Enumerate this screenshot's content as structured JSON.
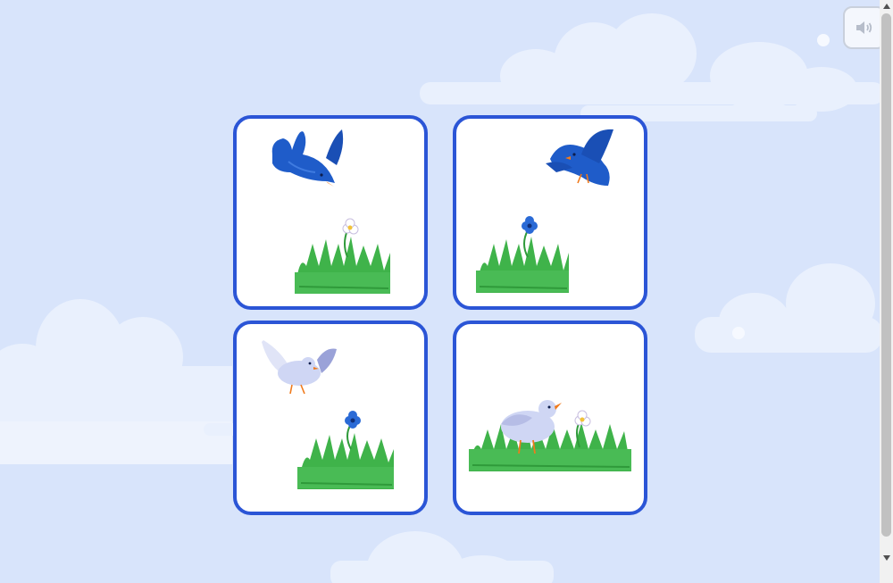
{
  "sound_button": {
    "icon": "speaker-icon",
    "state": "disabled"
  },
  "colors": {
    "sky": "#d8e4fb",
    "cloud": "#eef3fd",
    "card_border": "#2b55d6",
    "card_bg": "#ffffff",
    "bluebird": "#1f5cc9",
    "dove": "#cfd6f4",
    "grass": "#3fb34a",
    "beak": "#f07a1c"
  },
  "cards": [
    {
      "id": "card-1",
      "scene": "bluebird-flying-over-grass-with-white-flower",
      "icons": [
        "bluebird-icon",
        "grass-icon",
        "white-flower-icon"
      ]
    },
    {
      "id": "card-2",
      "scene": "bluebird-flying-over-grass-with-blue-flower",
      "icons": [
        "bluebird-icon",
        "grass-icon",
        "blue-flower-icon"
      ]
    },
    {
      "id": "card-3",
      "scene": "dove-flying-over-grass-with-blue-flower",
      "icons": [
        "dove-icon",
        "grass-icon",
        "blue-flower-icon"
      ]
    },
    {
      "id": "card-4",
      "scene": "dove-standing-in-grass-with-white-flower",
      "icons": [
        "dove-icon",
        "grass-icon",
        "white-flower-icon"
      ]
    }
  ]
}
